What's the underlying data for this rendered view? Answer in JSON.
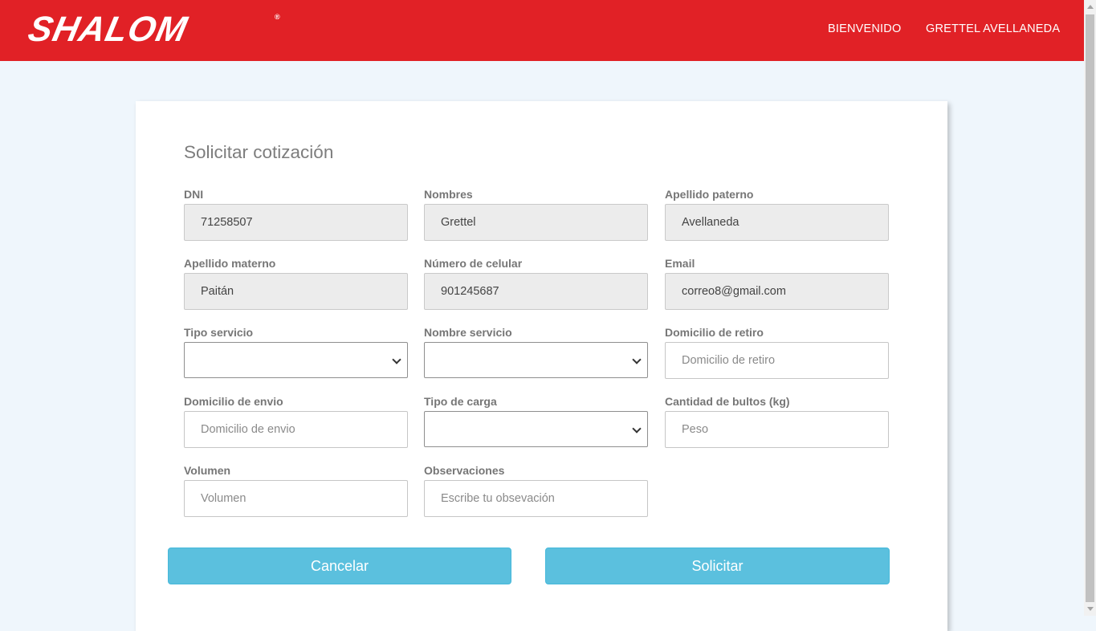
{
  "header": {
    "logo_text": "SHALOM",
    "logo_reg": "®",
    "nav_welcome": "BIENVENIDO",
    "nav_user": "GRETTEL AVELLANEDA"
  },
  "form": {
    "title": "Solicitar cotización",
    "dni": {
      "label": "DNI",
      "value": "71258507"
    },
    "nombres": {
      "label": "Nombres",
      "value": "Grettel"
    },
    "apellido_paterno": {
      "label": "Apellido paterno",
      "value": "Avellaneda"
    },
    "apellido_materno": {
      "label": "Apellido materno",
      "value": "Paitán"
    },
    "celular": {
      "label": "Número de celular",
      "value": "901245687"
    },
    "email": {
      "label": "Email",
      "value": "correo8@gmail.com"
    },
    "tipo_servicio": {
      "label": "Tipo servicio",
      "value": ""
    },
    "nombre_servicio": {
      "label": "Nombre servicio",
      "value": ""
    },
    "domicilio_retiro": {
      "label": "Domicilio de retiro",
      "placeholder": "Domicilio de retiro"
    },
    "domicilio_envio": {
      "label": "Domicilio de envio",
      "placeholder": "Domicilio de envio"
    },
    "tipo_carga": {
      "label": "Tipo de carga",
      "value": ""
    },
    "cantidad_bultos": {
      "label": "Cantidad de bultos (kg)",
      "placeholder": "Peso"
    },
    "volumen": {
      "label": "Volumen",
      "placeholder": "Volumen"
    },
    "observaciones": {
      "label": "Observaciones",
      "placeholder": "Escribe tu obsevación"
    }
  },
  "buttons": {
    "cancel_label": "Cancelar",
    "submit_label": "Solicitar"
  },
  "colors": {
    "header_bg": "#e12126",
    "page_bg": "#eff6fc",
    "button_bg": "#5bc0de"
  }
}
